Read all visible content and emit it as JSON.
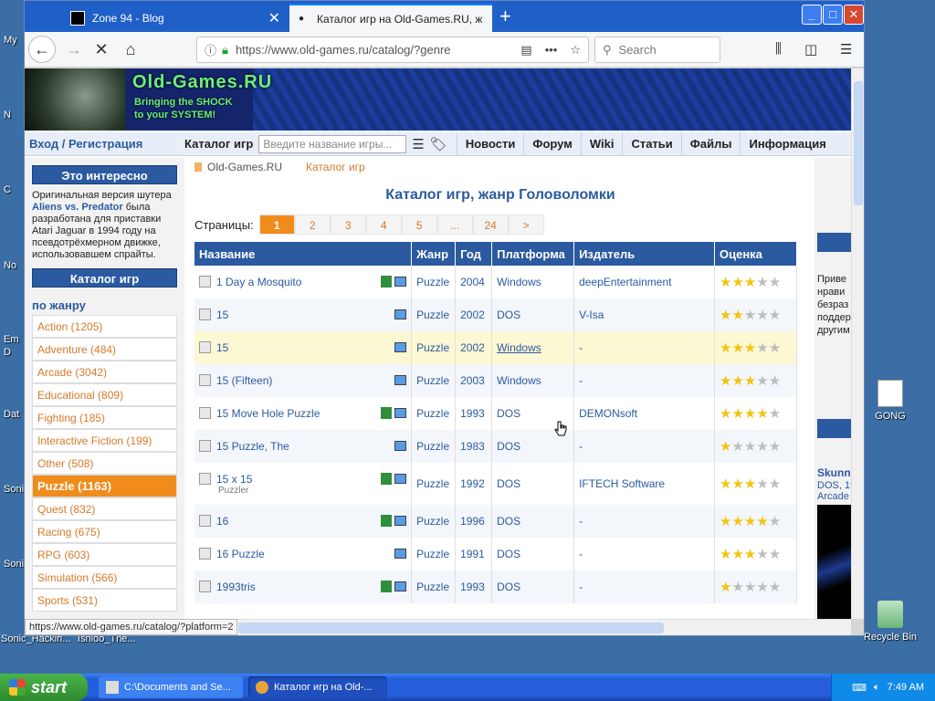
{
  "desktop": {
    "left_labels": [
      "My",
      "N",
      "C",
      "No",
      "Em",
      "D",
      "Dat",
      "Soni",
      "Soni"
    ],
    "bottom_labels": [
      "Sonic_Hackin...",
      "Ishido_The..."
    ],
    "icons": [
      {
        "label": "GONG",
        "icon": "media-file-icon"
      },
      {
        "label": "Recycle Bin",
        "icon": "recycle-bin-icon"
      }
    ]
  },
  "browser": {
    "tabs": [
      {
        "title": "Zone 94 - Blog"
      },
      {
        "title": "Каталог игр на Old-Games.RU, ж"
      }
    ],
    "url": "https://www.old-games.ru/catalog/?genre",
    "search_placeholder": "Search",
    "status_url": "https://www.old-games.ru/catalog/?platform=2"
  },
  "site": {
    "logo": "Old-Games.RU",
    "slogan_lines": [
      "Bringing the SHOCK",
      "to your SYSTEM!"
    ],
    "nav": {
      "login": "Вход / Регистрация",
      "catalog": "Каталог игр",
      "search_placeholder": "Введите название игры...",
      "menu": [
        "Новости",
        "Форум",
        "Wiki",
        "Статьи",
        "Файлы",
        "Информация"
      ]
    },
    "sidebar": {
      "interest_head": "Это интересно",
      "interest_pre": "Оригинальная версия шутера ",
      "interest_bold": "Aliens vs. Predator",
      "interest_post": " была разработана для приставки Atari Jaguar в 1994 году на псевдотрёхмерном движке, использовавшем спрайты.",
      "catalog_head": "Каталог игр",
      "by_genre": "по жанру",
      "genres": [
        "Action (1205)",
        "Adventure (484)",
        "Arcade (3042)",
        "Educational (809)",
        "Fighting (185)",
        "Interactive Fiction (199)",
        "Other (508)",
        "Puzzle (1163)",
        "Quest (832)",
        "Racing (675)",
        "RPG (603)",
        "Simulation (566)",
        "Sports (531)"
      ]
    },
    "breadcrumb": [
      "Old-Games.RU",
      "Каталог игр"
    ],
    "title": "Каталог игр, жанр Головоломки",
    "pager": {
      "label": "Страницы:",
      "pages": [
        "1",
        "2",
        "3",
        "4",
        "5",
        "...",
        "24",
        ">"
      ]
    },
    "table": {
      "headers": [
        "Название",
        "Жанр",
        "Год",
        "Платформа",
        "Издатель",
        "Оценка"
      ],
      "rows": [
        {
          "name": "1 Day a Mosquito",
          "sub": "",
          "genre": "Puzzle",
          "year": "2004",
          "platform": "Windows",
          "publisher": "deepEntertainment",
          "rating": 3
        },
        {
          "name": "15",
          "sub": "",
          "genre": "Puzzle",
          "year": "2002",
          "platform": "DOS",
          "publisher": "V-Isa",
          "rating": 2
        },
        {
          "name": "15",
          "sub": "",
          "genre": "Puzzle",
          "year": "2002",
          "platform": "Windows",
          "publisher": "-",
          "rating": 3
        },
        {
          "name": "15 (Fifteen)",
          "sub": "",
          "genre": "Puzzle",
          "year": "2003",
          "platform": "Windows",
          "publisher": "-",
          "rating": 3
        },
        {
          "name": "15 Move Hole Puzzle",
          "sub": "",
          "genre": "Puzzle",
          "year": "1993",
          "platform": "DOS",
          "publisher": "DEMONsoft",
          "rating": 4
        },
        {
          "name": "15 Puzzle, The",
          "sub": "",
          "genre": "Puzzle",
          "year": "1983",
          "platform": "DOS",
          "publisher": "-",
          "rating": 1
        },
        {
          "name": "15 x 15",
          "sub": "Puzzler",
          "genre": "Puzzle",
          "year": "1992",
          "platform": "DOS",
          "publisher": "IFTECH Software",
          "rating": 3
        },
        {
          "name": "16",
          "sub": "",
          "genre": "Puzzle",
          "year": "1996",
          "platform": "DOS",
          "publisher": "-",
          "rating": 4
        },
        {
          "name": "16 Puzzle",
          "sub": "",
          "genre": "Puzzle",
          "year": "1991",
          "platform": "DOS",
          "publisher": "-",
          "rating": 3
        },
        {
          "name": "1993tris",
          "sub": "",
          "genre": "Puzzle",
          "year": "1993",
          "platform": "DOS",
          "publisher": "-",
          "rating": 1
        }
      ]
    },
    "right": {
      "text_lines": [
        "Приве",
        "нрави",
        "безраз",
        "поддер",
        "другим"
      ],
      "game_title": "Skunn",
      "game_meta": [
        "DOS, 19",
        "Arcade"
      ]
    }
  },
  "taskbar": {
    "start": "start",
    "buttons": [
      "C:\\Documents and Se...",
      "Каталог игр на Old-..."
    ],
    "time": "7:49 AM"
  }
}
